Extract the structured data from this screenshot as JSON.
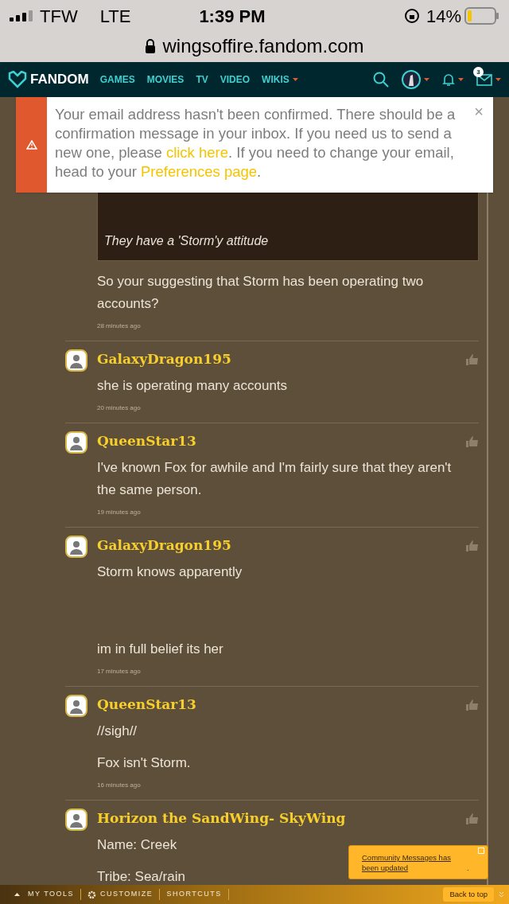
{
  "status_bar": {
    "carrier": "TFW",
    "network": "LTE",
    "time": "1:39 PM",
    "battery": "14%",
    "url": "wingsoffire.fandom.com"
  },
  "nav": {
    "logo": "FANDOM",
    "links": [
      {
        "label": "GAMES",
        "dropdown": false
      },
      {
        "label": "MOVIES",
        "dropdown": false
      },
      {
        "label": "TV",
        "dropdown": false
      },
      {
        "label": "VIDEO",
        "dropdown": false
      },
      {
        "label": "WIKIS",
        "dropdown": true
      }
    ],
    "badge": "3"
  },
  "banner": {
    "text": "Your email address hasn't been confirmed. There should be a confirmation message in your inbox. If you need us to send a new one, please ",
    "link1": "click here",
    "middle": ". If you need to change your email, head to your ",
    "link2": "Preferences page",
    "end": ".",
    "close": "×"
  },
  "quote": {
    "text": "They have a 'Storm'y attitude"
  },
  "comments": [
    {
      "paragraphs": [
        "So your suggesting that Storm has been operating two accounts?"
      ],
      "time": "28 minutes ago"
    },
    {
      "author": "GalaxyDragon195",
      "paragraphs": [
        "she is operating many accounts"
      ],
      "time": "20 minutes ago"
    },
    {
      "author": "QueenStar13",
      "paragraphs": [
        "I've known Fox for awhile and I'm fairly sure that they aren't the same person."
      ],
      "time": "19 minutes ago"
    },
    {
      "author": "GalaxyDragon195",
      "paragraphs": [
        "Storm knows apparently",
        "im in full belief its her"
      ],
      "spaced": true,
      "time": "17 minutes ago"
    },
    {
      "author": "QueenStar13",
      "paragraphs": [
        "//sigh//",
        "Fox isn't Storm."
      ],
      "time": "16 minutes ago"
    },
    {
      "author": "Horizon the SandWing- SkyWing",
      "paragraphs": [
        "Name: Creek",
        "Tribe: Sea/rain"
      ]
    }
  ],
  "popup": {
    "text": "Community Messages has been updated",
    "end": "."
  },
  "toolbar": {
    "items": [
      "MY TOOLS",
      "CUSTOMIZE",
      "SHORTCUTS"
    ],
    "back": "Back to top"
  }
}
